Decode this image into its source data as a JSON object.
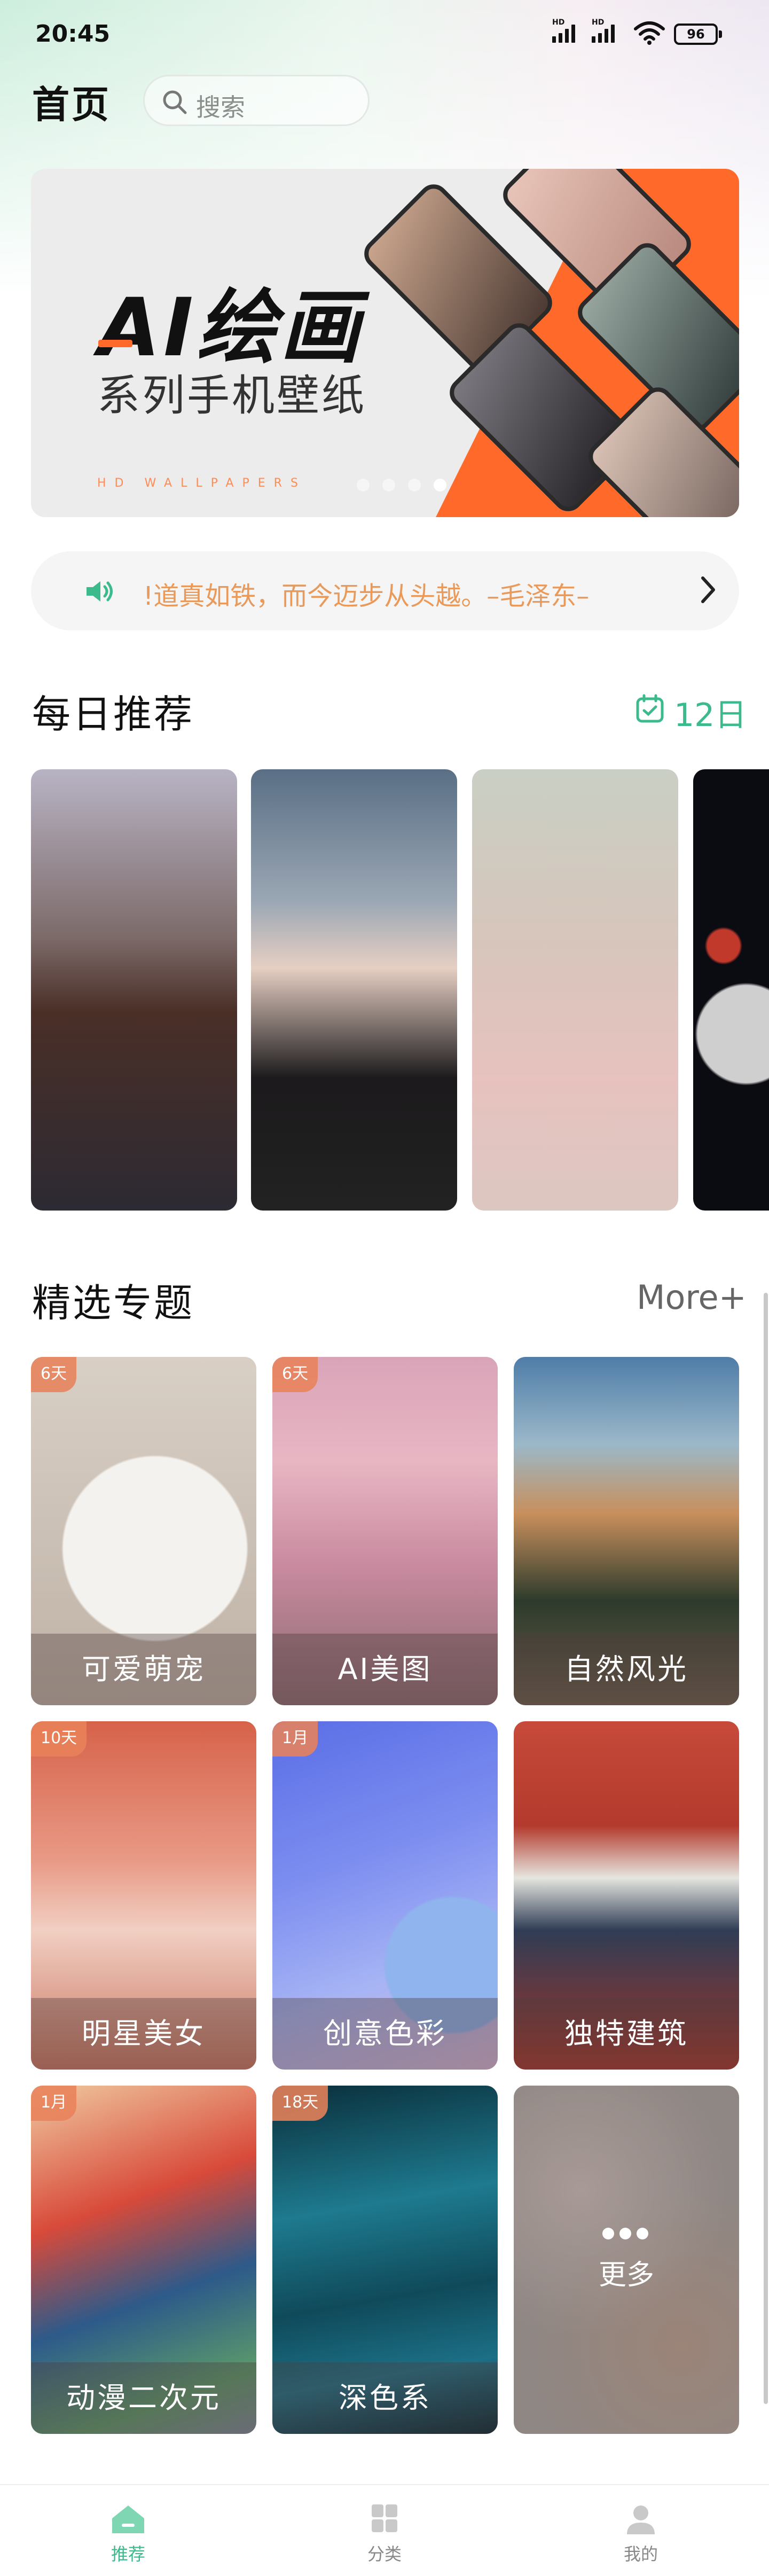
{
  "status_bar": {
    "time": "20:45",
    "network_1": "HD",
    "network_2": "HD",
    "battery": "96"
  },
  "header": {
    "title": "首页",
    "search_placeholder": "搜索"
  },
  "banner": {
    "headline": "AI绘画",
    "subtitle": "系列手机壁纸",
    "tagline": "HD WALLPAPERS",
    "page_count": 4,
    "active_page": 4
  },
  "notice": {
    "text": "!道真如铁，而今迈步从头越。–毛泽东–"
  },
  "daily": {
    "title": "每日推荐",
    "date": "12日",
    "items": 4
  },
  "topics": {
    "title": "精选专题",
    "more_label": "More+",
    "items": [
      {
        "label": "可爱萌宠",
        "badge": "6天"
      },
      {
        "label": "AI美图",
        "badge": "6天"
      },
      {
        "label": "自然风光",
        "badge": ""
      },
      {
        "label": "明星美女",
        "badge": "10天"
      },
      {
        "label": "创意色彩",
        "badge": "1月"
      },
      {
        "label": "独特建筑",
        "badge": ""
      },
      {
        "label": "动漫二次元",
        "badge": "1月"
      },
      {
        "label": "深色系",
        "badge": "18天"
      },
      {
        "label": "更多",
        "badge": ""
      }
    ]
  },
  "tabbar": {
    "items": [
      {
        "label": "推荐",
        "active": true
      },
      {
        "label": "分类",
        "active": false
      },
      {
        "label": "我的",
        "active": false
      }
    ]
  },
  "colors": {
    "accent": "#3bba8c",
    "banner_orange": "#ff6a2a",
    "notice_text": "#e99a5b"
  }
}
